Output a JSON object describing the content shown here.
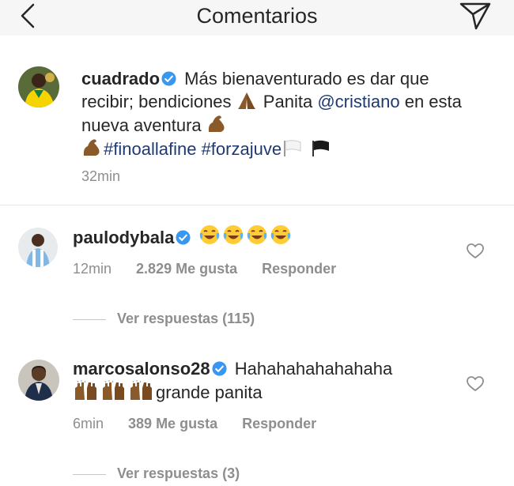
{
  "header": {
    "title": "Comentarios"
  },
  "post": {
    "username": "cuadrado",
    "caption_part1": "Más bienaventurado es dar que recibir; bendiciones",
    "caption_part2": "Panita",
    "mention": "@cristiano",
    "caption_part3": "en esta nueva aventura",
    "hashtag1": "#finoallafine",
    "hashtag2": "#forzajuve",
    "time": "32min"
  },
  "comments": [
    {
      "username": "paulodybala",
      "time": "12min",
      "likes": "2.829 Me gusta",
      "reply_label": "Responder",
      "view_replies": "Ver respuestas (115)"
    },
    {
      "username": "marcosalonso28",
      "text_part1": "Hahahahahahahaha",
      "text_part2": "grande panita",
      "time": "6min",
      "likes": "389 Me gusta",
      "reply_label": "Responder",
      "view_replies": "Ver respuestas (3)"
    }
  ],
  "colors": {
    "verified": "#3897f0",
    "link": "#1e3a73",
    "secondary_text": "#8e8e8e",
    "header_bg": "#f6f6f6"
  },
  "icons": [
    "back-arrow-icon",
    "send-icon",
    "verified-icon",
    "heart-icon",
    "pray-emoji",
    "flexed-biceps-emoji",
    "white-flag-emoji",
    "black-flag-emoji",
    "laughing-tears-emoji",
    "raised-hands-emoji"
  ]
}
